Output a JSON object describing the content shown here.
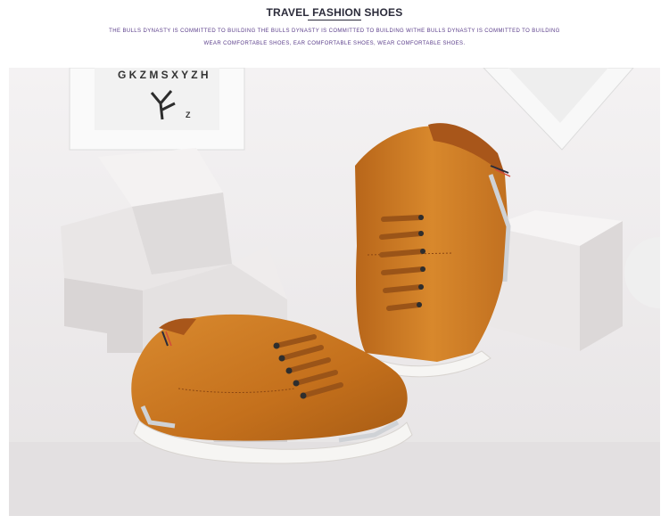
{
  "header": {
    "title": "TRAVEL FASHION SHOES",
    "subtitle_line1": "THE BULLS DYNASTY IS COMMITTED TO BUILDING THE BULLS DYNASTY IS COMMITTED TO BUILDING WITHE BULLS DYNASTY IS COMMITTED TO BUILDING",
    "subtitle_line2": "WEAR COMFORTABLE SHOES, EAR COMFORTABLE SHOES, WEAR COMFORTABLE SHOES."
  },
  "photo": {
    "frame_art_letters": "G K Z M S X Y Z H",
    "frame_art_initial": "Z"
  },
  "colors": {
    "leather": "#c8741e",
    "sole": "#f6f5f3",
    "lace": "#9a5418",
    "cube": "#ebe8e7",
    "title": "#2b2b3a",
    "subtitle": "#5a3d8a"
  }
}
